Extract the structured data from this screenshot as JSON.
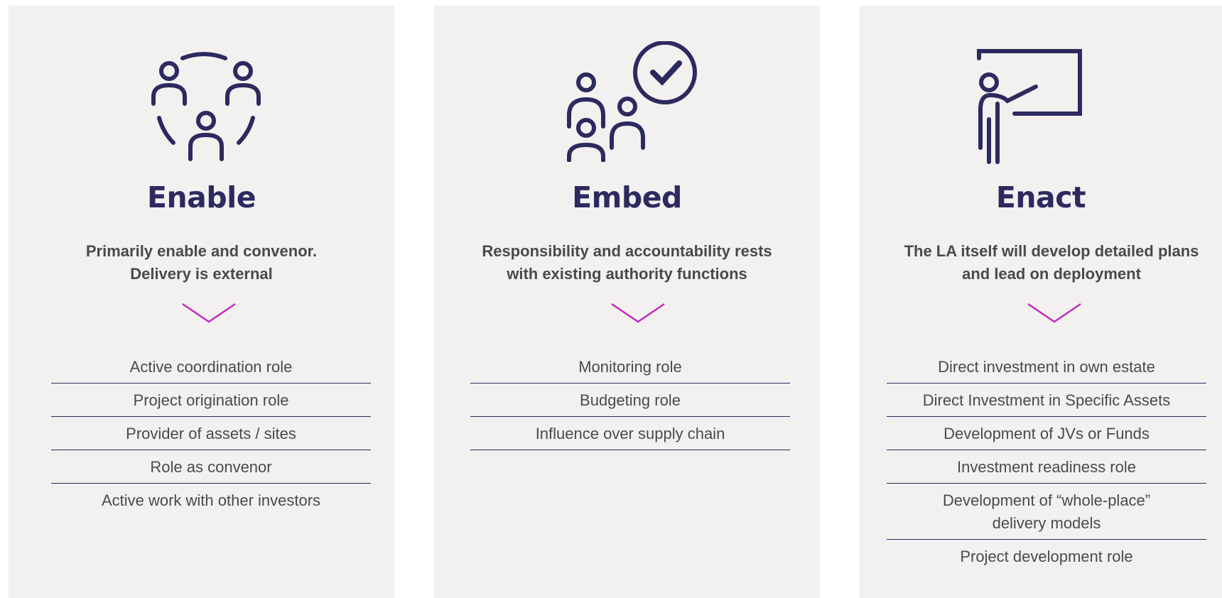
{
  "colors": {
    "navy": "#2c2a5f",
    "accent": "#c22bbd",
    "card": "#f2f1f0",
    "text": "#4a4a4a"
  },
  "columns": [
    {
      "icon": "people-circle-icon",
      "title": "Enable",
      "desc_lines": [
        "Primarily enable and convenor.",
        "Delivery is external"
      ],
      "roles": [
        "Active coordination role",
        "Project origination role",
        "Provider of assets / sites",
        "Role as convenor",
        "Active work with other investors"
      ]
    },
    {
      "icon": "people-check-icon",
      "title": "Embed",
      "desc_lines": [
        "Responsibility and accountability rests",
        "with existing authority functions"
      ],
      "roles": [
        "Monitoring role",
        "Budgeting role",
        "Influence over supply chain"
      ]
    },
    {
      "icon": "presenter-board-icon",
      "title": "Enact",
      "desc_lines": [
        "The LA itself will develop detailed plans",
        "and lead on deployment"
      ],
      "roles": [
        "Direct investment in own estate",
        "Direct Investment in Specific Assets",
        "Development of JVs or Funds",
        "Investment readiness role",
        "Development of “whole-place”",
        "delivery models",
        "Project development role"
      ]
    }
  ]
}
